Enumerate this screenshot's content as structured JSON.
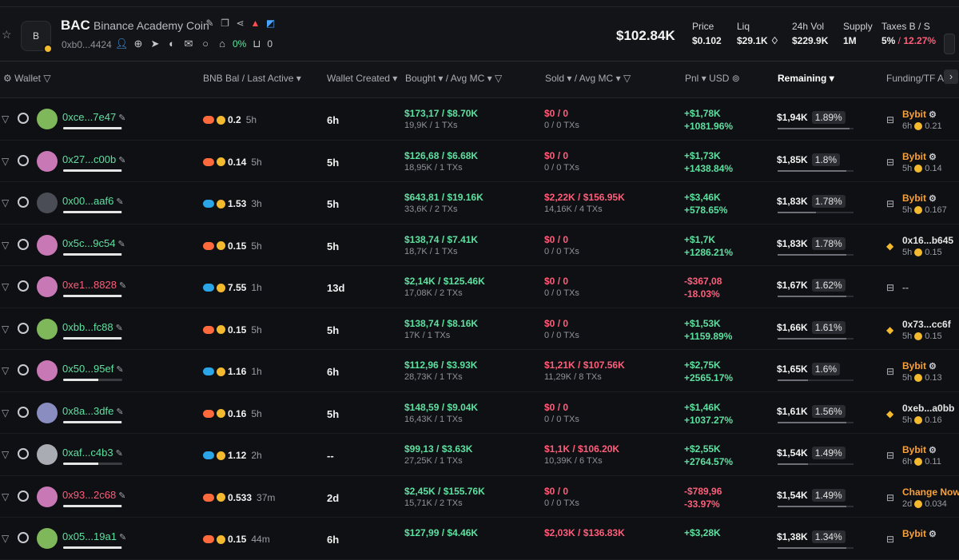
{
  "token": {
    "logo_letter": "B",
    "ticker": "BAC",
    "name": "Binance Academy Coin",
    "address": "0xb0...4424",
    "holders_pct": "0%",
    "watchers": "0"
  },
  "stats": {
    "market_cap": "$102.84K",
    "price_label": "Price",
    "price": "$0.102",
    "liq_label": "Liq",
    "liq": "$29.1K",
    "vol_label": "24h Vol",
    "vol": "$229.9K",
    "supply_label": "Supply",
    "supply": "1M",
    "taxes_label": "Taxes B / S",
    "tax_buy": "5%",
    "tax_sep": " / ",
    "tax_sell": "12.27%"
  },
  "columns": {
    "wallet": "Wallet",
    "bnb_bal": "BNB Bal",
    "last_active": "/ Last Active",
    "wallet_created": "Wallet Created",
    "bought": "Bought",
    "avg_mc_b": "/ Avg MC",
    "sold": "Sold",
    "avg_mc_s": "/ Avg MC",
    "pnl": "Pnl",
    "usd": "USD",
    "remaining": "Remaining",
    "funding": "Funding/TF A"
  },
  "colors": {
    "green": "#5ee0a0",
    "red": "#ff5d7a",
    "orange": "#f8a13a",
    "bnb": "#f3ba2f"
  },
  "rows": [
    {
      "addr": "0xce...7e47",
      "addr_color": "green",
      "bar": 0.98,
      "avatar": "#7fb85a",
      "src": "#ff6a3d",
      "bnb": "0.2",
      "active": "5h",
      "created": "6h",
      "bought": "$173,17",
      "bought_mc": "$8.70K",
      "bought_sub": "19,9K / 1 TXs",
      "sold": "$0",
      "sold_mc": "0",
      "sold_sub": "0 / 0 TXs",
      "sold_red": true,
      "pnl": "+$1,78K",
      "pnl_pct": "+1081.96%",
      "pnl_pos": true,
      "rem": "$1,94K",
      "rem_pct": "1.89%",
      "rem_fill": 0.95,
      "fund": "Bybit",
      "fund_type": "gear",
      "fund_color": "orange",
      "fund_ago": "6h",
      "fund_amt": "0.21"
    },
    {
      "addr": "0x27...c00b",
      "addr_color": "green",
      "bar": 0.98,
      "avatar": "#c978b6",
      "src": "#ff6a3d",
      "bnb": "0.14",
      "active": "5h",
      "created": "5h",
      "bought": "$126,68",
      "bought_mc": "$6.68K",
      "bought_sub": "18,95K / 1 TXs",
      "sold": "$0",
      "sold_mc": "0",
      "sold_sub": "0 / 0 TXs",
      "sold_red": true,
      "pnl": "+$1,73K",
      "pnl_pct": "+1438.84%",
      "pnl_pos": true,
      "rem": "$1,85K",
      "rem_pct": "1.8%",
      "rem_fill": 0.9,
      "fund": "Bybit",
      "fund_type": "gear",
      "fund_color": "orange",
      "fund_ago": "5h",
      "fund_amt": "0.14"
    },
    {
      "addr": "0x00...aaf6",
      "addr_color": "green",
      "bar": 0.98,
      "avatar": "#4a4d55",
      "src": "#2aa6e8",
      "bnb": "1.53",
      "active": "3h",
      "created": "5h",
      "bought": "$643,81",
      "bought_mc": "$19.16K",
      "bought_sub": "33,6K / 2 TXs",
      "sold": "$2,22K",
      "sold_mc": "$156.95K",
      "sold_sub": "14,16K / 4 TXs",
      "sold_red": true,
      "pnl": "+$3,46K",
      "pnl_pct": "+578.65%",
      "pnl_pos": true,
      "rem": "$1,83K",
      "rem_pct": "1.78%",
      "rem_fill": 0.5,
      "fund": "Bybit",
      "fund_type": "gear",
      "fund_color": "orange",
      "fund_ago": "5h",
      "fund_amt": "0.167"
    },
    {
      "addr": "0x5c...9c54",
      "addr_color": "green",
      "bar": 0.98,
      "avatar": "#c978b6",
      "src": "#ff6a3d",
      "bnb": "0.15",
      "active": "5h",
      "created": "5h",
      "bought": "$138,74",
      "bought_mc": "$7.41K",
      "bought_sub": "18,7K / 1 TXs",
      "sold": "$0",
      "sold_mc": "0",
      "sold_sub": "0 / 0 TXs",
      "sold_red": true,
      "pnl": "+$1,7K",
      "pnl_pct": "+1286.21%",
      "pnl_pos": true,
      "rem": "$1,83K",
      "rem_pct": "1.78%",
      "rem_fill": 0.9,
      "fund": "0x16...b645",
      "fund_type": "bnb",
      "fund_color": "white",
      "fund_ago": "5h",
      "fund_amt": "0.15"
    },
    {
      "addr": "0xe1...8828",
      "addr_color": "red",
      "bar": 0.98,
      "avatar": "#c978b6",
      "src": "#2aa6e8",
      "bnb": "7.55",
      "active": "1h",
      "created": "13d",
      "bought": "$2,14K",
      "bought_mc": "$125.46K",
      "bought_sub": "17,08K / 2 TXs",
      "sold": "$0",
      "sold_mc": "0",
      "sold_sub": "0 / 0 TXs",
      "sold_red": true,
      "pnl": "-$367,08",
      "pnl_pct": "-18.03%",
      "pnl_pos": false,
      "rem": "$1,67K",
      "rem_pct": "1.62%",
      "rem_fill": 0.9,
      "fund": "--",
      "fund_type": "none",
      "fund_color": "grey",
      "fund_ago": "",
      "fund_amt": ""
    },
    {
      "addr": "0xbb...fc88",
      "addr_color": "green",
      "bar": 0.98,
      "avatar": "#7fb85a",
      "src": "#ff6a3d",
      "bnb": "0.15",
      "active": "5h",
      "created": "5h",
      "bought": "$138,74",
      "bought_mc": "$8.16K",
      "bought_sub": "17K / 1 TXs",
      "sold": "$0",
      "sold_mc": "0",
      "sold_sub": "0 / 0 TXs",
      "sold_red": true,
      "pnl": "+$1,53K",
      "pnl_pct": "+1159.89%",
      "pnl_pos": true,
      "rem": "$1,66K",
      "rem_pct": "1.61%",
      "rem_fill": 0.9,
      "fund": "0x73...cc6f",
      "fund_type": "bnb",
      "fund_color": "white",
      "fund_ago": "5h",
      "fund_amt": "0.15"
    },
    {
      "addr": "0x50...95ef",
      "addr_color": "green",
      "bar": 0.6,
      "avatar": "#c978b6",
      "src": "#2aa6e8",
      "bnb": "1.16",
      "active": "1h",
      "created": "6h",
      "bought": "$112,96",
      "bought_mc": "$3.93K",
      "bought_sub": "28,73K / 1 TXs",
      "sold": "$1,21K",
      "sold_mc": "$107.56K",
      "sold_sub": "11,29K / 8 TXs",
      "sold_red": true,
      "pnl": "+$2,75K",
      "pnl_pct": "+2565.17%",
      "pnl_pos": true,
      "rem": "$1,65K",
      "rem_pct": "1.6%",
      "rem_fill": 0.4,
      "fund": "Bybit",
      "fund_type": "gear",
      "fund_color": "orange",
      "fund_ago": "5h",
      "fund_amt": "0.13"
    },
    {
      "addr": "0x8a...3dfe",
      "addr_color": "green",
      "bar": 0.98,
      "avatar": "#8a8dc0",
      "src": "#ff6a3d",
      "bnb": "0.16",
      "active": "5h",
      "created": "5h",
      "bought": "$148,59",
      "bought_mc": "$9.04K",
      "bought_sub": "16,43K / 1 TXs",
      "sold": "$0",
      "sold_mc": "0",
      "sold_sub": "0 / 0 TXs",
      "sold_red": true,
      "pnl": "+$1,46K",
      "pnl_pct": "+1037.27%",
      "pnl_pos": true,
      "rem": "$1,61K",
      "rem_pct": "1.56%",
      "rem_fill": 0.9,
      "fund": "0xeb...a0bb",
      "fund_type": "bnb",
      "fund_color": "white",
      "fund_ago": "5h",
      "fund_amt": "0.16"
    },
    {
      "addr": "0xaf...c4b3",
      "addr_color": "green",
      "bar": 0.6,
      "avatar": "#a9acb3",
      "src": "#2aa6e8",
      "bnb": "1.12",
      "active": "2h",
      "created": "--",
      "bought": "$99,13",
      "bought_mc": "$3.63K",
      "bought_sub": "27,25K / 1 TXs",
      "sold": "$1,1K",
      "sold_mc": "$106.20K",
      "sold_sub": "10,39K / 6 TXs",
      "sold_red": true,
      "pnl": "+$2,55K",
      "pnl_pct": "+2764.57%",
      "pnl_pos": true,
      "rem": "$1,54K",
      "rem_pct": "1.49%",
      "rem_fill": 0.4,
      "fund": "Bybit",
      "fund_type": "gear",
      "fund_color": "orange",
      "fund_ago": "6h",
      "fund_amt": "0.11"
    },
    {
      "addr": "0x93...2c68",
      "addr_color": "red",
      "bar": 0.98,
      "avatar": "#c978b6",
      "src": "#ff6a3d",
      "bnb": "0.533",
      "active": "37m",
      "created": "2d",
      "bought": "$2,45K",
      "bought_mc": "$155.76K",
      "bought_sub": "15,71K / 2 TXs",
      "sold": "$0",
      "sold_mc": "0",
      "sold_sub": "0 / 0 TXs",
      "sold_red": true,
      "pnl": "-$789,96",
      "pnl_pct": "-33.97%",
      "pnl_pos": false,
      "rem": "$1,54K",
      "rem_pct": "1.49%",
      "rem_fill": 0.9,
      "fund": "Change Now",
      "fund_type": "gear",
      "fund_color": "orange",
      "fund_ago": "2d",
      "fund_amt": "0.034"
    },
    {
      "addr": "0x05...19a1",
      "addr_color": "green",
      "bar": 0.98,
      "avatar": "#7fb85a",
      "src": "#ff6a3d",
      "bnb": "0.15",
      "active": "44m",
      "created": "6h",
      "bought": "$127,99",
      "bought_mc": "$4.46K",
      "bought_sub": "",
      "sold": "$2,03K",
      "sold_mc": "$136.83K",
      "sold_sub": "",
      "sold_red": true,
      "pnl": "+$3,28K",
      "pnl_pct": "",
      "pnl_pos": true,
      "rem": "$1,38K",
      "rem_pct": "1.34%",
      "rem_fill": 0.9,
      "fund": "Bybit",
      "fund_type": "gear",
      "fund_color": "orange",
      "fund_ago": "",
      "fund_amt": ""
    }
  ]
}
